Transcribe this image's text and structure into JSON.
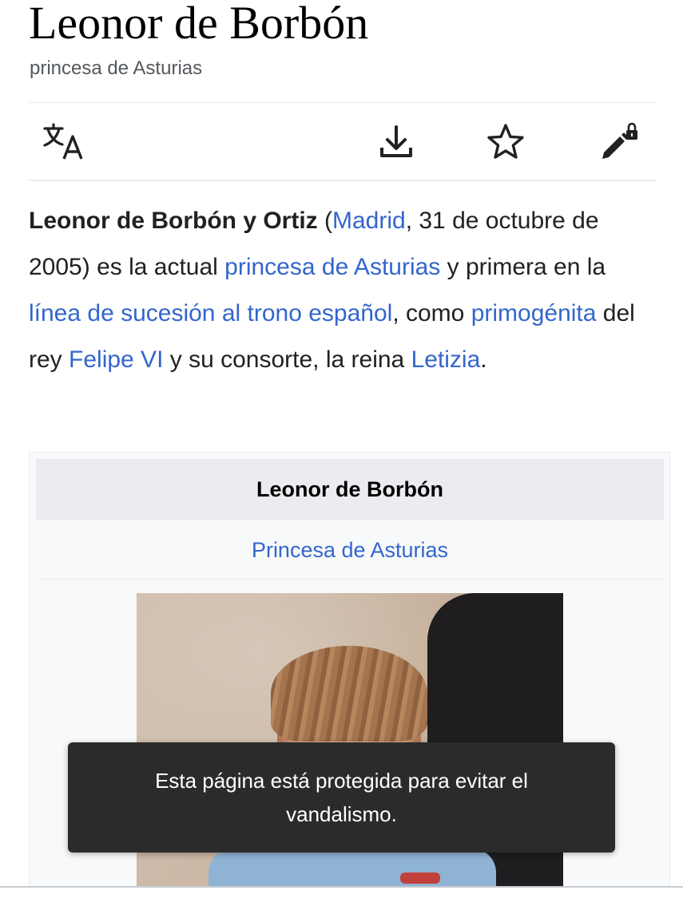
{
  "page": {
    "title": "Leonor de Borbón",
    "subtitle": "princesa de Asturias"
  },
  "toolbar": {
    "language_icon": "translate-icon",
    "download_icon": "download-icon",
    "watch_icon": "star-icon",
    "edit_icon": "edit-protected-icon"
  },
  "lead": {
    "bold": "Leonor de Borbón y Ortiz",
    "t1": " (",
    "link_madrid": "Madrid",
    "t2": ", 31 de octubre de 2005) es la actual ",
    "link_princesa": "princesa de Asturias",
    "t3": " y primera en la ",
    "link_linea": "línea de sucesión al trono español",
    "t4": ", como ",
    "link_primogenita": "primogénita",
    "t5": " del rey ",
    "link_felipe": "Felipe VI",
    "t6": " y su consorte, la reina ",
    "link_letizia": "Letizia",
    "t7": "."
  },
  "infobox": {
    "heading": "Leonor de Borbón",
    "title_link": "Princesa de Asturias"
  },
  "toast": {
    "message": "Esta página está protegida para evitar el vandalismo."
  },
  "colors": {
    "link": "#3366cc",
    "text": "#202122",
    "toast_bg": "#2b2b2b"
  }
}
